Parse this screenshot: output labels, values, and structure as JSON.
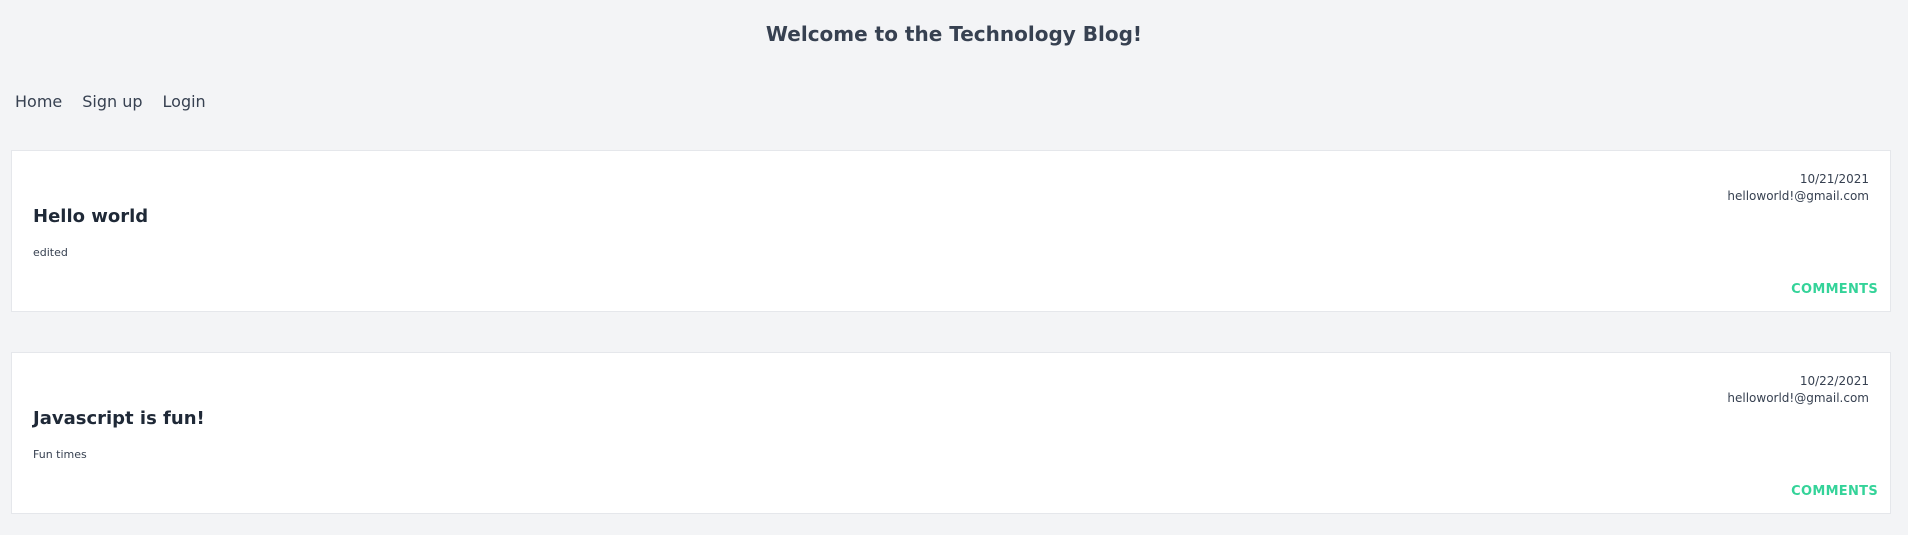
{
  "header": {
    "title": "Welcome to the Technology Blog!"
  },
  "nav": {
    "items": [
      {
        "label": "Home"
      },
      {
        "label": "Sign up"
      },
      {
        "label": "Login"
      }
    ]
  },
  "posts": [
    {
      "date": "10/21/2021",
      "author": "helloworld!@gmail.com",
      "title": "Hello world",
      "body": "edited",
      "comments_label": "COMMENTS"
    },
    {
      "date": "10/22/2021",
      "author": "helloworld!@gmail.com",
      "title": "Javascript is fun!",
      "body": "Fun times",
      "comments_label": "COMMENTS"
    }
  ],
  "colors": {
    "background": "#f3f4f6",
    "card": "#ffffff",
    "accent": "#34d399",
    "text": "#374151"
  }
}
